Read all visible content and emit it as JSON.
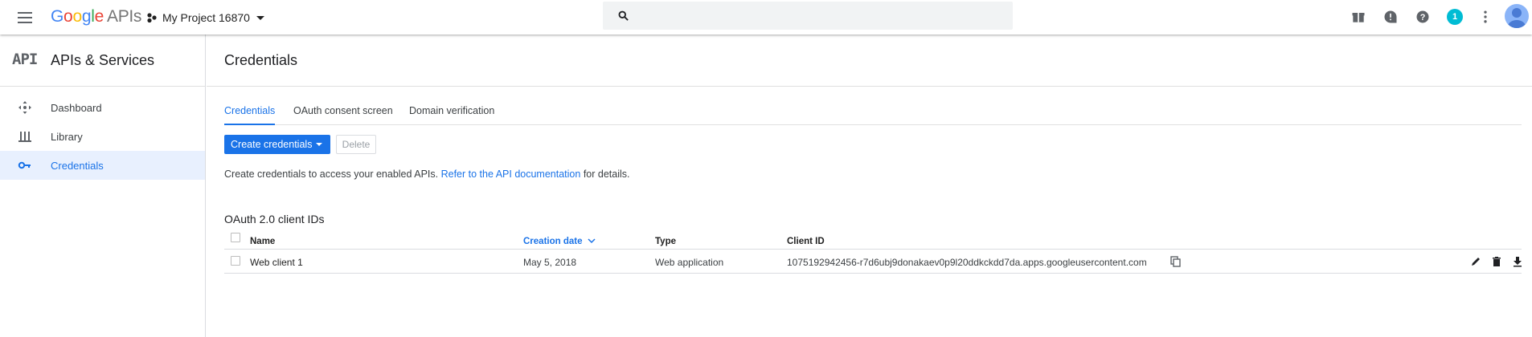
{
  "topbar": {
    "logo": [
      "G",
      "o",
      "o",
      "g",
      "l",
      "e"
    ],
    "logo_suffix": "APIs",
    "project_name": "My Project 16870",
    "search_placeholder": "",
    "notification_count": "1"
  },
  "sidebar": {
    "logo": "API",
    "title": "APIs & Services",
    "items": [
      {
        "label": "Dashboard",
        "icon": "dashboard-icon"
      },
      {
        "label": "Library",
        "icon": "library-icon"
      },
      {
        "label": "Credentials",
        "icon": "key-icon",
        "active": true
      }
    ]
  },
  "main": {
    "title": "Credentials",
    "tabs": [
      {
        "label": "Credentials",
        "active": true
      },
      {
        "label": "OAuth consent screen"
      },
      {
        "label": "Domain verification"
      }
    ],
    "create_button": "Create credentials",
    "delete_button": "Delete",
    "info_text": "Create credentials to access your enabled APIs.",
    "info_link": "Refer to the API documentation",
    "info_suffix": "for details.",
    "section_title": "OAuth 2.0 client IDs",
    "table": {
      "columns": [
        "Name",
        "Creation date",
        "Type",
        "Client ID"
      ],
      "sorted_column": "Creation date",
      "rows": [
        {
          "name": "Web client 1",
          "creation_date": "May 5, 2018",
          "type": "Web application",
          "client_id": "1075192942456-r7d6ubj9donakaev0p9l20ddkckdd7da.apps.googleusercontent.com"
        }
      ]
    }
  },
  "colors": {
    "accent": "#1a73e8",
    "active_nav_bg": "#e8f0fe",
    "badge": "#00bcd4"
  }
}
